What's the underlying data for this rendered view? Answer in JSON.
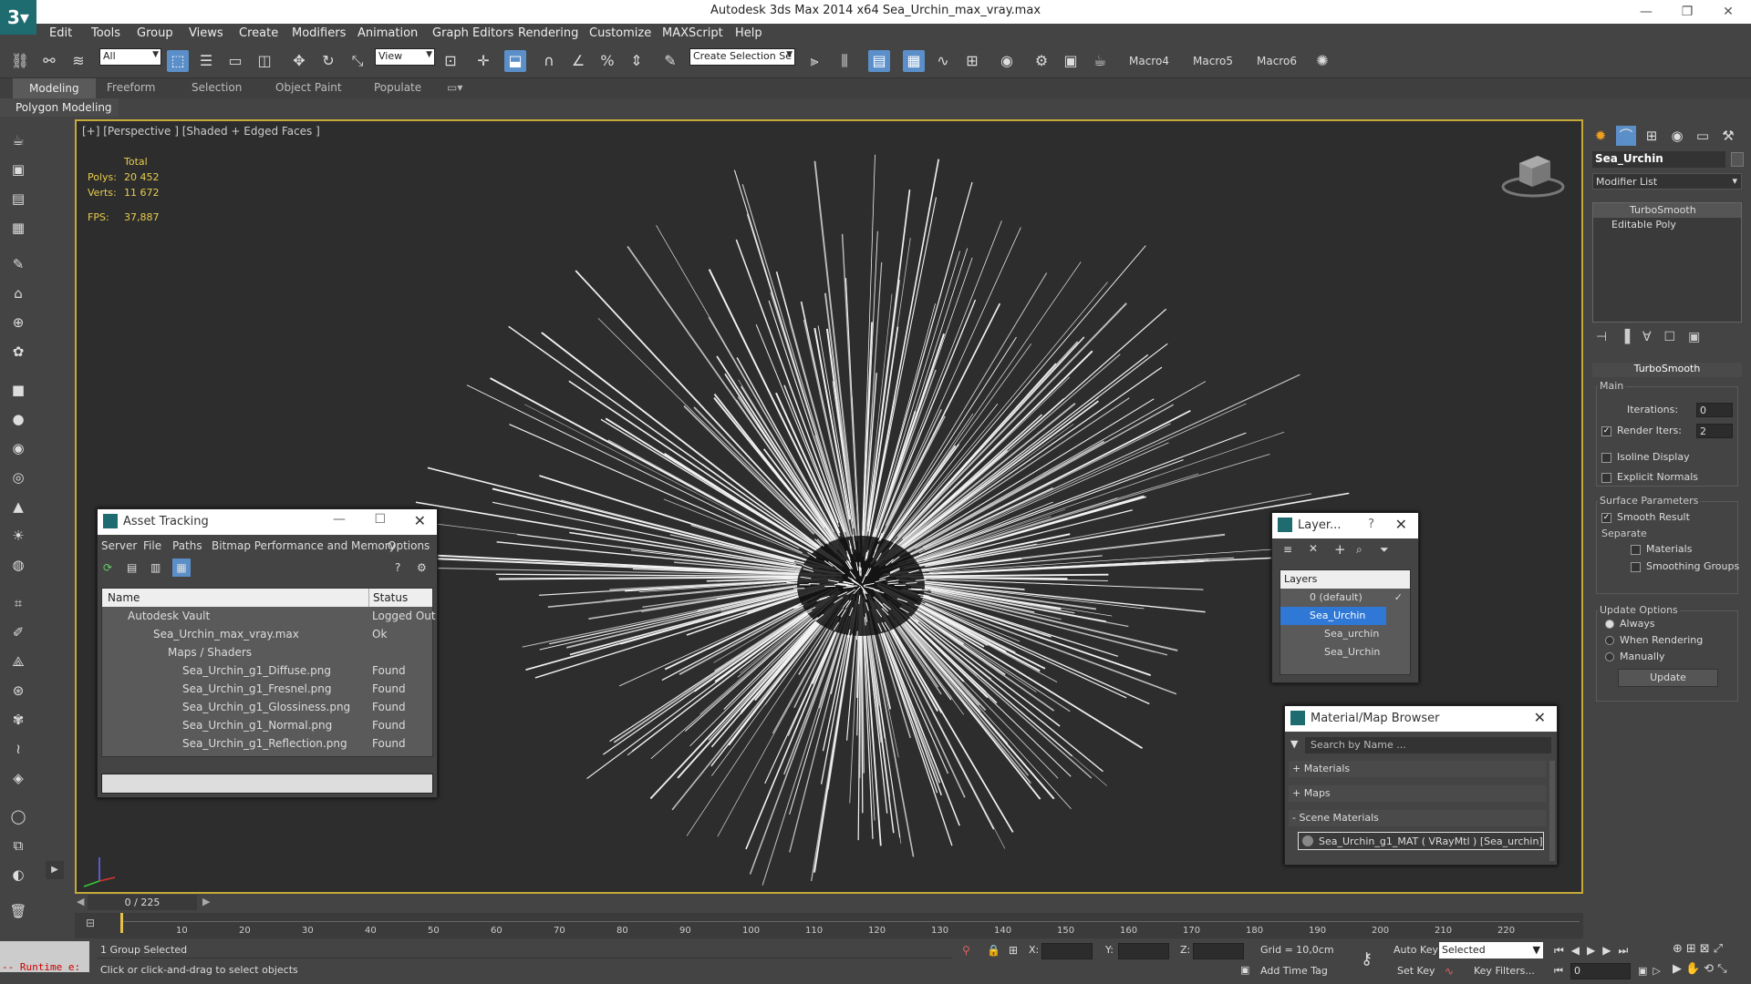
{
  "app": {
    "title": "Autodesk 3ds Max  2014 x64     Sea_Urchin_max_vray.max"
  },
  "menu": [
    "Edit",
    "Tools",
    "Group",
    "Views",
    "Create",
    "Modifiers",
    "Animation",
    "Graph Editors",
    "Rendering",
    "Customize",
    "MAXScript",
    "Help"
  ],
  "toolbar": {
    "filter_value": "All",
    "view_value": "View",
    "selection_set_placeholder": "Create Selection Se",
    "macros": [
      "Macro4",
      "Macro5",
      "Macro6"
    ]
  },
  "ribbon": {
    "tabs": [
      "Modeling",
      "Freeform",
      "Selection",
      "Object Paint",
      "Populate"
    ],
    "active_tab": "Modeling",
    "subpanel": "Polygon Modeling"
  },
  "viewport": {
    "label": "[+] [Perspective ] [Shaded + Edged Faces ]",
    "stats_header": "Total",
    "polys_label": "Polys:",
    "polys_value": "20 452",
    "verts_label": "Verts:",
    "verts_value": "11 672",
    "fps_label": "FPS:",
    "fps_value": "37,887"
  },
  "asset_tracking": {
    "title": "Asset Tracking",
    "menu": [
      "Server",
      "File",
      "Paths",
      "Bitmap Performance and Memory",
      "Options"
    ],
    "col_name": "Name",
    "col_status": "Status",
    "rows": [
      {
        "name": "Autodesk Vault",
        "status": "Logged Out"
      },
      {
        "name": "Sea_Urchin_max_vray.max",
        "status": "Ok"
      },
      {
        "name": "Maps / Shaders",
        "status": ""
      },
      {
        "name": "Sea_Urchin_g1_Diffuse.png",
        "status": "Found"
      },
      {
        "name": "Sea_Urchin_g1_Fresnel.png",
        "status": "Found"
      },
      {
        "name": "Sea_Urchin_g1_Glossiness.png",
        "status": "Found"
      },
      {
        "name": "Sea_Urchin_g1_Normal.png",
        "status": "Found"
      },
      {
        "name": "Sea_Urchin_g1_Reflection.png",
        "status": "Found"
      }
    ]
  },
  "layers": {
    "title": "Layer...",
    "help": "?",
    "header": "Layers",
    "items": [
      "0 (default)",
      "Sea_Urchin",
      "Sea_urchin",
      "Sea_Urchin"
    ]
  },
  "material_browser": {
    "title": "Material/Map Browser",
    "search_placeholder": "Search by Name ...",
    "sections": [
      "+ Materials",
      "+ Maps",
      "- Scene Materials"
    ],
    "material": "Sea_Urchin_g1_MAT ( VRayMtl ) [Sea_urchin]"
  },
  "command_panel": {
    "object_name": "Sea_Urchin",
    "modifier_list": "Modifier List",
    "stack": [
      "TurboSmooth",
      "Editable Poly"
    ],
    "rollout_title": "TurboSmooth",
    "main_label": "Main",
    "iterations_label": "Iterations:",
    "iterations_value": "0",
    "render_iters_label": "Render Iters:",
    "render_iters_value": "2",
    "isoline": "Isoline Display",
    "explicit": "Explicit Normals",
    "surface_label": "Surface Parameters",
    "smooth_result": "Smooth Result",
    "separate_label": "Separate",
    "materials": "Materials",
    "smoothing_groups": "Smoothing Groups",
    "update_options": "Update Options",
    "always": "Always",
    "when_rendering": "When Rendering",
    "manually": "Manually",
    "update_button": "Update"
  },
  "timeline": {
    "frame": "0 / 225",
    "ticks": [
      "10",
      "20",
      "30",
      "40",
      "50",
      "60",
      "70",
      "80",
      "90",
      "100",
      "110",
      "120",
      "130",
      "140",
      "150",
      "160",
      "170",
      "180",
      "190",
      "200",
      "210",
      "220"
    ]
  },
  "status": {
    "runtime": "-- Runtime e:",
    "selected": "1 Group Selected",
    "prompt": "Click or click-and-drag to select objects",
    "x_label": "X:",
    "y_label": "Y:",
    "z_label": "Z:",
    "grid": "Grid = 10,0cm",
    "add_time_tag": "Add Time Tag",
    "auto_key": "Auto Key",
    "set_key": "Set Key",
    "key_mode": "Selected",
    "key_filters": "Key Filters...",
    "frame_value": "0"
  }
}
